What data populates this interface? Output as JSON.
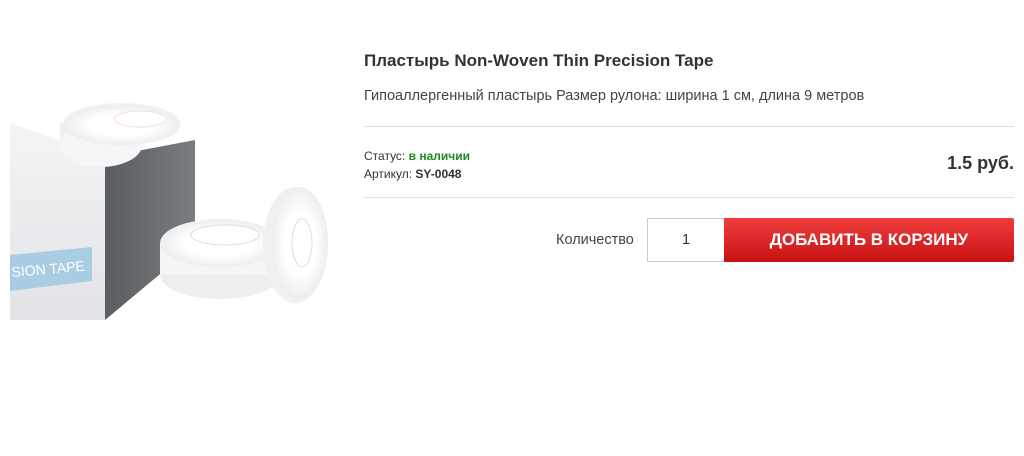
{
  "product": {
    "title": "Пластырь Non-Woven Thin Precision Tape",
    "description": "Гипоаллергенный пластырь Размер рулона: ширина 1 см, длина 9 метров",
    "image_label": "SION TAPE",
    "status_label": "Статус:",
    "status_value": "в наличии",
    "sku_label": "Артикул:",
    "sku_value": "SY-0048",
    "price": "1.5 руб."
  },
  "cart": {
    "quantity_label": "Количество",
    "quantity_value": "1",
    "add_button_label": "ДОБАВИТЬ В КОРЗИНУ"
  },
  "colors": {
    "accent": "#d41f1f",
    "in_stock": "#1f8a1f"
  }
}
